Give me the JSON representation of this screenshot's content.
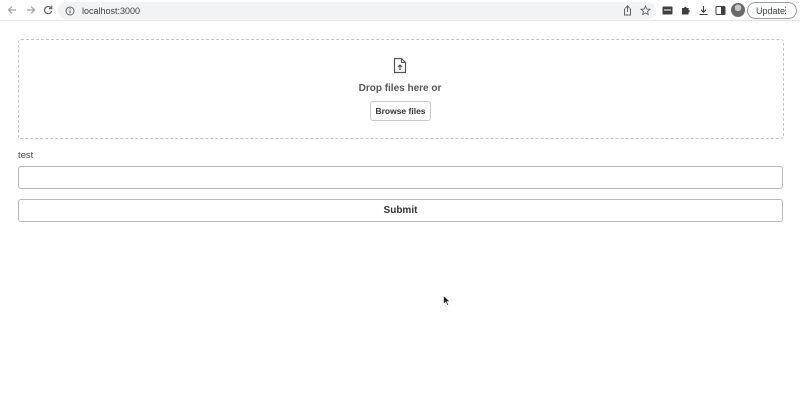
{
  "browser": {
    "url": "localhost:3000",
    "update_label": "Update",
    "icons": [
      "back-icon",
      "forward-icon",
      "reload-icon",
      "site-info-icon",
      "share-icon",
      "bookmark-star-icon",
      "media-icon",
      "extensions-icon",
      "download-icon",
      "side-panel-icon",
      "profile-avatar",
      "kebab-menu-icon"
    ]
  },
  "dropzone": {
    "icon": "file-upload-icon",
    "prompt": "Drop files here or",
    "browse_label": "Browse files"
  },
  "form": {
    "field_label": "test",
    "field_value": "",
    "field_placeholder": "",
    "submit_label": "Submit"
  },
  "colors": {
    "border": "#c4c4c4",
    "text": "#333333",
    "omnibox_bg": "#f1f3f4"
  }
}
